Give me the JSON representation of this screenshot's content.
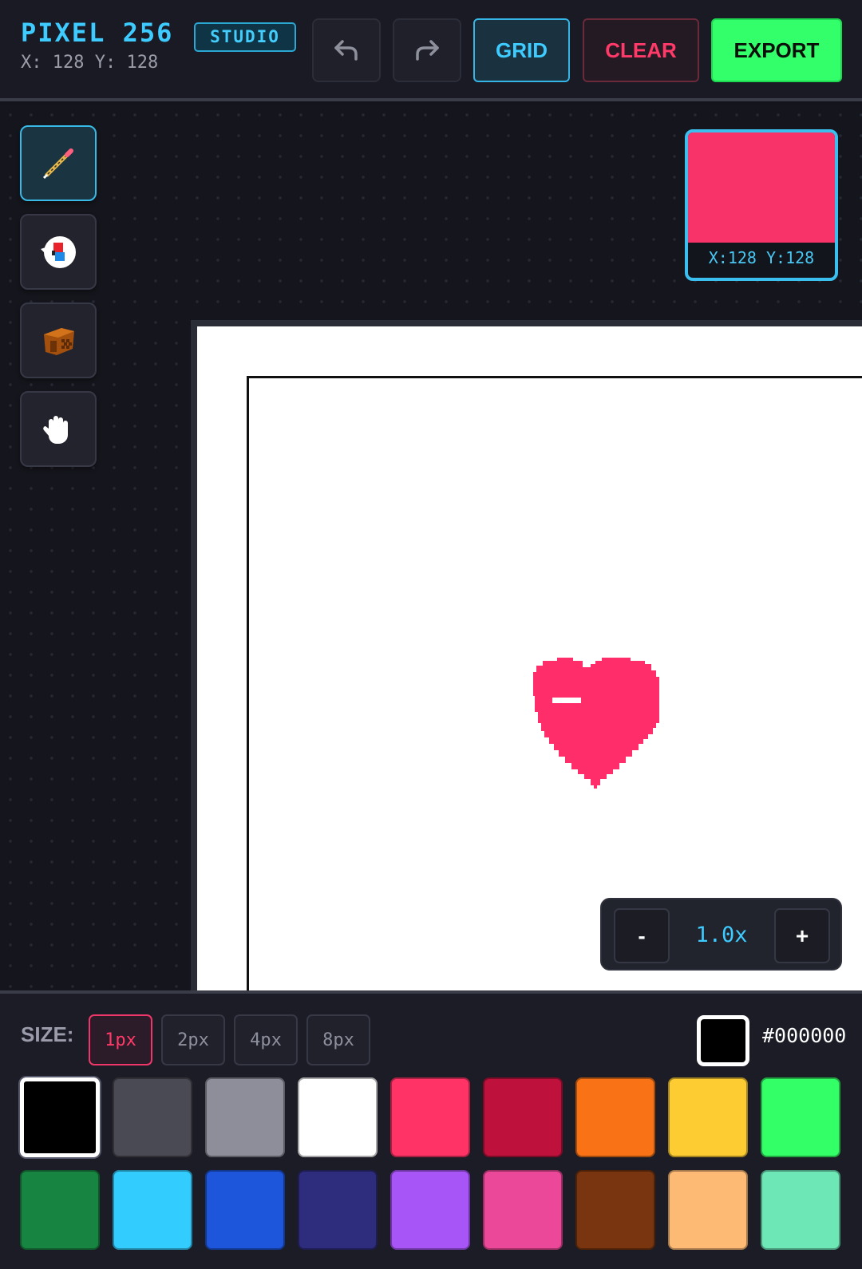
{
  "header": {
    "brand": "PIXEL 256",
    "badge": "STUDIO",
    "coords": "X: 128 Y: 128",
    "undo_icon": "undo-arrow-icon",
    "redo_icon": "redo-arrow-icon",
    "grid_label": "GRID",
    "clear_label": "CLEAR",
    "export_label": "EXPORT"
  },
  "tools": [
    {
      "name": "pencil",
      "icon": "pencil-icon",
      "active": true
    },
    {
      "name": "eraser",
      "icon": "eraser-icon",
      "active": false
    },
    {
      "name": "fill",
      "icon": "paint-bucket-icon",
      "active": false
    },
    {
      "name": "pan",
      "icon": "hand-icon",
      "active": false
    }
  ],
  "preview": {
    "coords": "X:128 Y:128",
    "color": "#f7336a"
  },
  "zoom": {
    "minus": "-",
    "level": "1.0x",
    "plus": "+"
  },
  "bottom": {
    "size_label": "SIZE:",
    "sizes": [
      "1px",
      "2px",
      "4px",
      "8px"
    ],
    "active_size": "1px",
    "current_color": "#000000",
    "hex_label": "#000000"
  },
  "palette": [
    "#000000",
    "#4a4a54",
    "#8e8e9a",
    "#ffffff",
    "#ff3366",
    "#be123c",
    "#f97316",
    "#fccc32",
    "#33ff66",
    "#178541",
    "#33ccff",
    "#1d55db",
    "#2e2c7c",
    "#a855f7",
    "#ec4899",
    "#78350f",
    "#fdba74",
    "#6ee7b7"
  ],
  "selected_color": "#000000",
  "colors": {
    "accent": "#3ecbff",
    "danger": "#ff3a68",
    "success": "#33ff6a",
    "heart": "#ff2d69"
  }
}
